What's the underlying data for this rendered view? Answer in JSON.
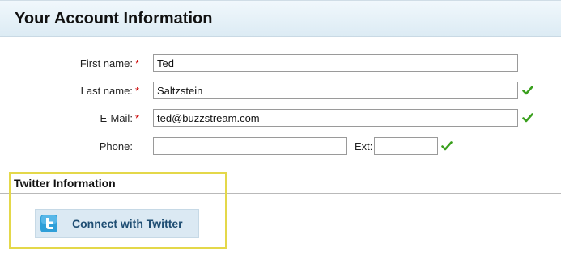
{
  "header": {
    "title": "Your Account Information"
  },
  "form": {
    "first_name": {
      "label": "First name:",
      "required_mark": "*",
      "value": "Ted"
    },
    "last_name": {
      "label": "Last name:",
      "required_mark": "*",
      "value": "Saltzstein"
    },
    "email": {
      "label": "E-Mail:",
      "required_mark": "*",
      "value": "ted@buzzstream.com"
    },
    "phone": {
      "label": "Phone:",
      "value": "",
      "ext_label": "Ext:",
      "ext_value": ""
    }
  },
  "twitter": {
    "section_title": "Twitter Information",
    "connect_label": "Connect with Twitter",
    "icon": "twitter-bird-icon"
  },
  "colors": {
    "highlight_border": "#e4d84a",
    "required": "#cc0000",
    "check": "#3aa01e",
    "button_bg": "#dbe9f3",
    "button_text": "#1f4e73"
  }
}
